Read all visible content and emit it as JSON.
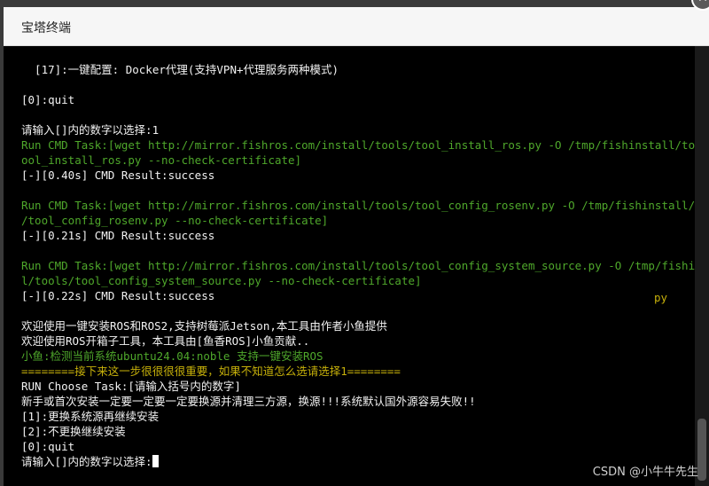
{
  "window": {
    "title": "宝塔终端",
    "close_glyph": "✕"
  },
  "terminal": {
    "lines": [
      {
        "text": "  [17]:一键配置: Docker代理(支持VPN+代理服务两种模式)",
        "color": "white"
      },
      {
        "text": "",
        "color": "white"
      },
      {
        "text": "[0]:quit",
        "color": "white"
      },
      {
        "text": "",
        "color": "white"
      },
      {
        "text": "请输入[]内的数字以选择:1",
        "color": "white"
      },
      {
        "text": "Run CMD Task:[wget http://mirror.fishros.com/install/tools/tool_install_ros.py -O /tmp/fishinstall/tools/t",
        "color": "green"
      },
      {
        "text": "ool_install_ros.py --no-check-certificate]",
        "color": "green"
      },
      {
        "text": "[-][0.40s] CMD Result:success",
        "color": "white"
      },
      {
        "text": "",
        "color": "white"
      },
      {
        "text": "Run CMD Task:[wget http://mirror.fishros.com/install/tools/tool_config_rosenv.py -O /tmp/fishinstall/tools",
        "color": "green"
      },
      {
        "text": "/tool_config_rosenv.py --no-check-certificate]",
        "color": "green"
      },
      {
        "text": "[-][0.21s] CMD Result:success",
        "color": "white"
      },
      {
        "text": "",
        "color": "white"
      },
      {
        "text": "Run CMD Task:[wget http://mirror.fishros.com/install/tools/tool_config_system_source.py -O /tmp/fishinstal",
        "color": "green"
      },
      {
        "text": "l/tools/tool_config_system_source.py --no-check-certificate]",
        "color": "green"
      },
      {
        "text": "[-][0.22s] CMD Result:success",
        "color": "white"
      },
      {
        "text": "",
        "color": "white"
      },
      {
        "text": "欢迎使用一键安装ROS和ROS2,支持树莓派Jetson,本工具由作者小鱼提供",
        "color": "white"
      },
      {
        "text": "欢迎使用ROS开箱子工具，本工具由[鱼香ROS]小鱼贡献..",
        "color": "white"
      },
      {
        "text": "小鱼:检测当前系统ubuntu24.04:noble 支持一键安装ROS",
        "color": "green"
      },
      {
        "text": "========接下来这一步很很很很重要，如果不知道怎么选请选择1========",
        "color": "yellow"
      },
      {
        "text": "RUN Choose Task:[请输入括号内的数字]",
        "color": "white"
      },
      {
        "text": "新手或首次安装一定要一定要一定要换源并清理三方源，换源!!!系统默认国外源容易失败!!",
        "color": "white"
      },
      {
        "text": "[1]:更换系统源再继续安装",
        "color": "white"
      },
      {
        "text": "[2]:不更换继续安装",
        "color": "white"
      },
      {
        "text": "[0]:quit",
        "color": "white"
      },
      {
        "text": "请输入[]内的数字以选择:",
        "color": "white",
        "cursor": true
      }
    ],
    "stray_text": "py"
  },
  "watermark": "CSDN @小牛牛先生",
  "colors": {
    "green": "#4fa82b",
    "yellow": "#c6b00a",
    "background": "#000000",
    "titlebar": "#f6f6f6"
  }
}
